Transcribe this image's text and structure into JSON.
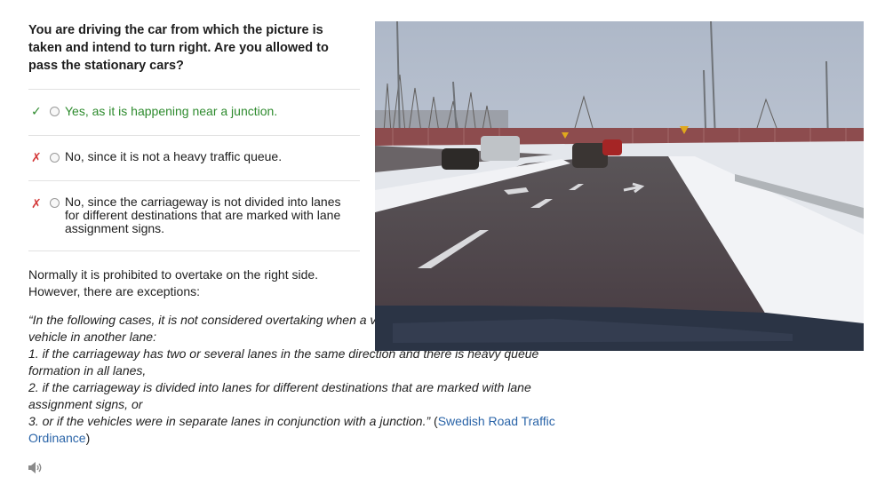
{
  "question": {
    "text": "You are driving the car from which the picture is taken and intend to turn right. Are you allowed to pass the stationary cars?"
  },
  "answers": [
    {
      "mark": "✓",
      "text": "Yes, as it is happening near a junction."
    },
    {
      "mark": "✗",
      "text": "No, since it is not a heavy traffic queue."
    },
    {
      "mark": "✗",
      "text": "No, since the carriageway is not divided into lanes for different destinations that are marked with lane assignment signs."
    }
  ],
  "explanation": {
    "line1": "Normally it is prohibited to overtake on the right side.",
    "line2": "However, there are exceptions:",
    "quote_intro": "“In the following cases, it is not considered overtaking when a vehicle in one lane passes a vehicle in another lane:",
    "quote_item1": "1. if the carriageway has two or several lanes in the same direction and there is heavy queue formation in all lanes,",
    "quote_item2": "2. if the carriageway is divided into lanes for different destinations that are marked with lane assignment signs, or",
    "quote_item3": "3. or if the vehicles were in separate lanes in conjunction with a junction.”",
    "source_open": " (",
    "source_link": "Swedish Road Traffic Ordinance",
    "source_close": ")"
  },
  "icons": {
    "correct": "check-icon",
    "wrong": "cross-icon",
    "audio": "speaker-icon"
  },
  "colors": {
    "correct": "#2e8b2e",
    "wrong": "#d43a3a",
    "link": "#2a64a8"
  }
}
